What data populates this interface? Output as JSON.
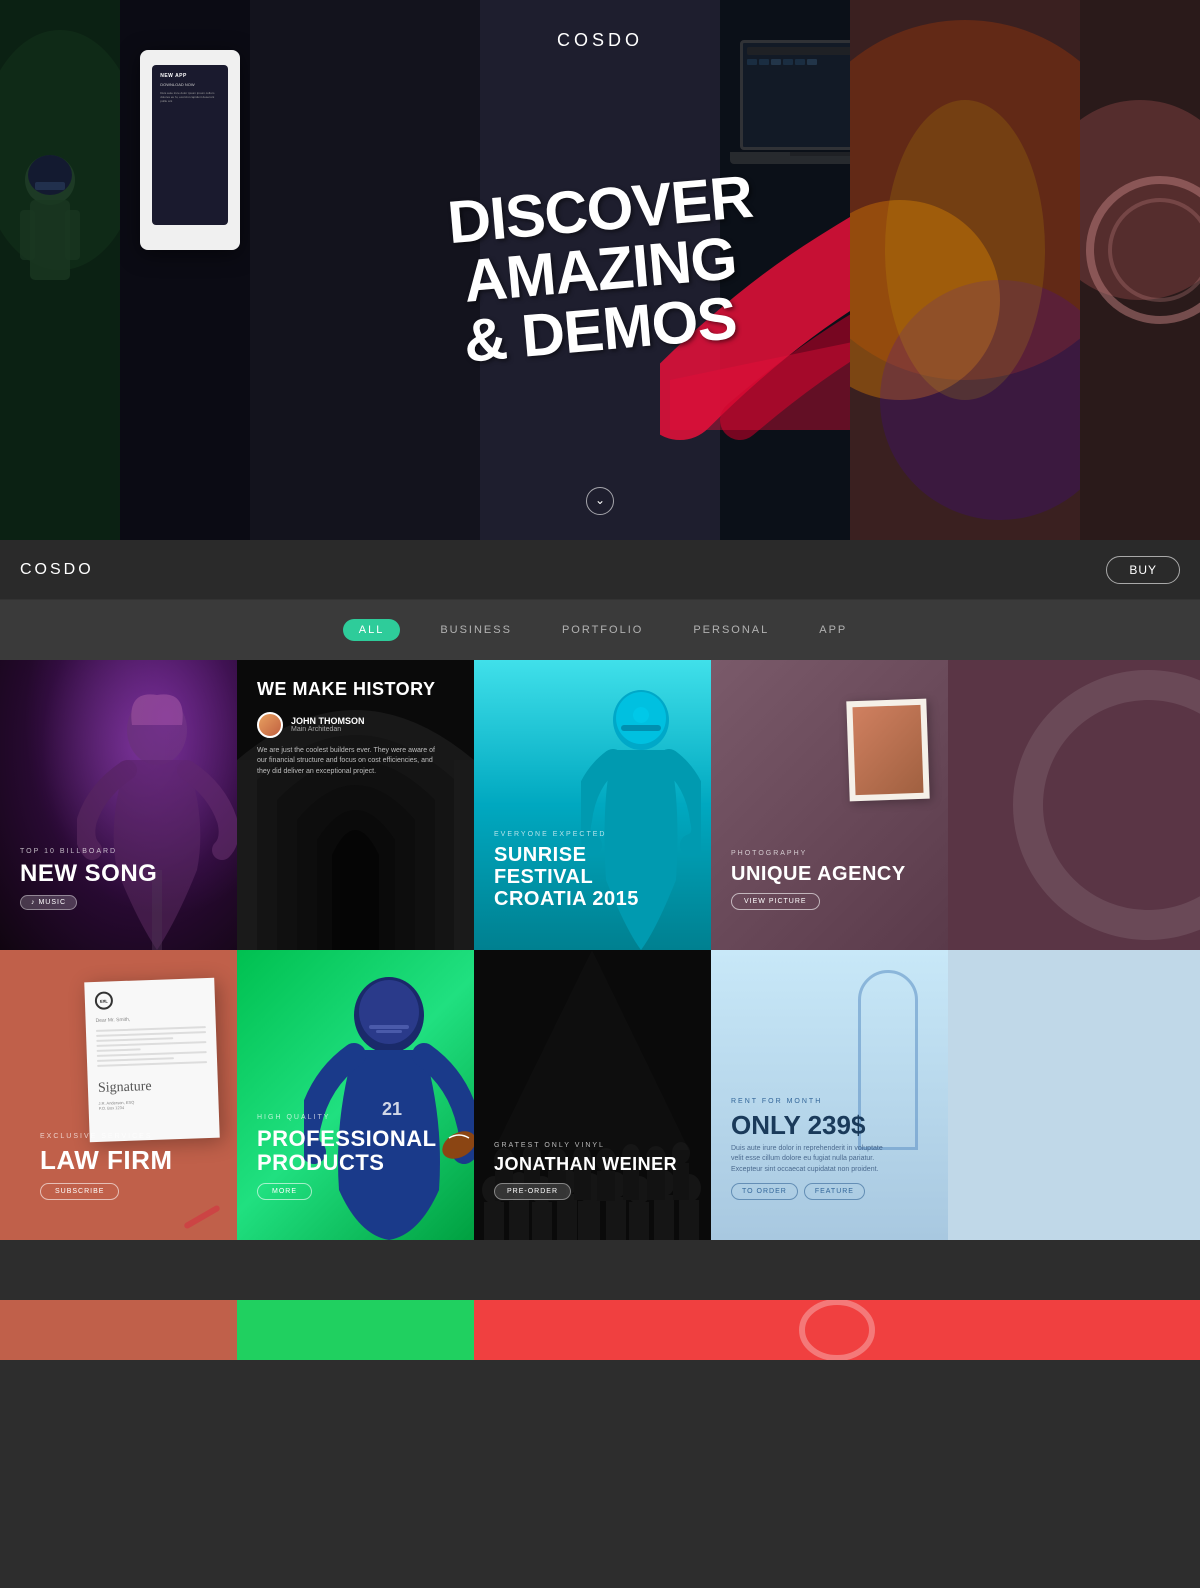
{
  "hero": {
    "logo": "COSDO",
    "brush_line1": "DISCOVER",
    "brush_line2": "AMAZING",
    "brush_line3": "& DEMOS"
  },
  "navbar": {
    "logo": "COSDO",
    "buy_label": "BUY"
  },
  "filter": {
    "tabs": [
      {
        "label": "ALL",
        "active": true
      },
      {
        "label": "BUSINESS",
        "active": false
      },
      {
        "label": "PORTFOLIO",
        "active": false
      },
      {
        "label": "PERSONAL",
        "active": false
      },
      {
        "label": "APP",
        "active": false
      }
    ]
  },
  "grid": {
    "row1": [
      {
        "eyebrow": "TOP 10 BILLBOARD",
        "title": "NEW SONG",
        "badge": "♪  MUSIC"
      },
      {
        "title": "WE MAKE HISTORY",
        "author_name": "JOHN THOMSON",
        "author_role": "Main Architedan",
        "desc": "We are just the coolest builders ever. They were aware of our financial structure and focus on cost efficiencies, and they did deliver an exceptional project."
      },
      {
        "eyebrow": "EVERYONE EXPECTED",
        "title": "SUNRISE FESTIVAL CROATIA 2015"
      },
      {
        "eyebrow": "PHOTOGRAPHY",
        "title": "UNIQUE AGENCY",
        "btn": "VIEW PICTURE"
      }
    ],
    "row2": [
      {
        "eyebrow": "EXCLUSIVE SERVICES",
        "title": "LAW FIRM",
        "btn": "SUBSCRIBE"
      },
      {
        "eyebrow": "HIGH QUALITY",
        "title": "PROFESSIONAL PRODUCTS",
        "btn": "MORE"
      },
      {
        "eyebrow": "GRATEST ONLY VINYL",
        "title": "JONATHAN WEINER",
        "btn": "PRE-ORDER"
      },
      {
        "eyebrow": "RENT FOR MONTH",
        "title": "ONLY 239$",
        "desc": "Duis aute irure dolor in reprehenderit in voluptate velit esse cillum dolore eu fugiat nulla pariatur. Excepteur sint occaecat cupidatat non proident.",
        "btn1": "TO ORDER",
        "btn2": "FEATURE"
      }
    ]
  },
  "app_mockup": {
    "title": "NEW APP",
    "subtitle": "DOWNLOAD NOW",
    "text": "Duis aute irure dolor ipsum ipsum collum dolores eu fu, exorcist capidunt deserunt polliu ant"
  }
}
